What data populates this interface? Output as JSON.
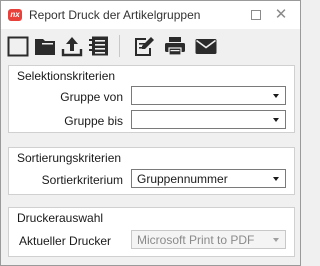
{
  "window": {
    "title": "Report Druck der Artikelgruppen",
    "logo_text": "nx",
    "close_glyph": "✕"
  },
  "toolbar": {
    "icons": [
      "new-document-icon",
      "open-folder-icon",
      "upload-icon",
      "list-icon",
      "edit-icon",
      "printer-icon",
      "mail-icon"
    ]
  },
  "selection": {
    "title": "Selektionskriterien",
    "group_from_label": "Gruppe von",
    "group_from_value": "",
    "group_to_label": "Gruppe bis",
    "group_to_value": ""
  },
  "sorting": {
    "title": "Sortierungskriterien",
    "criterion_label": "Sortierkriterium",
    "criterion_value": "Gruppennummer"
  },
  "printer": {
    "title": "Druckerauswahl",
    "current_label": "Aktueller Drucker",
    "current_value": "Microsoft Print to PDF"
  },
  "colors": {
    "logo": "#e8413b",
    "icon": "#2b2b2b"
  }
}
